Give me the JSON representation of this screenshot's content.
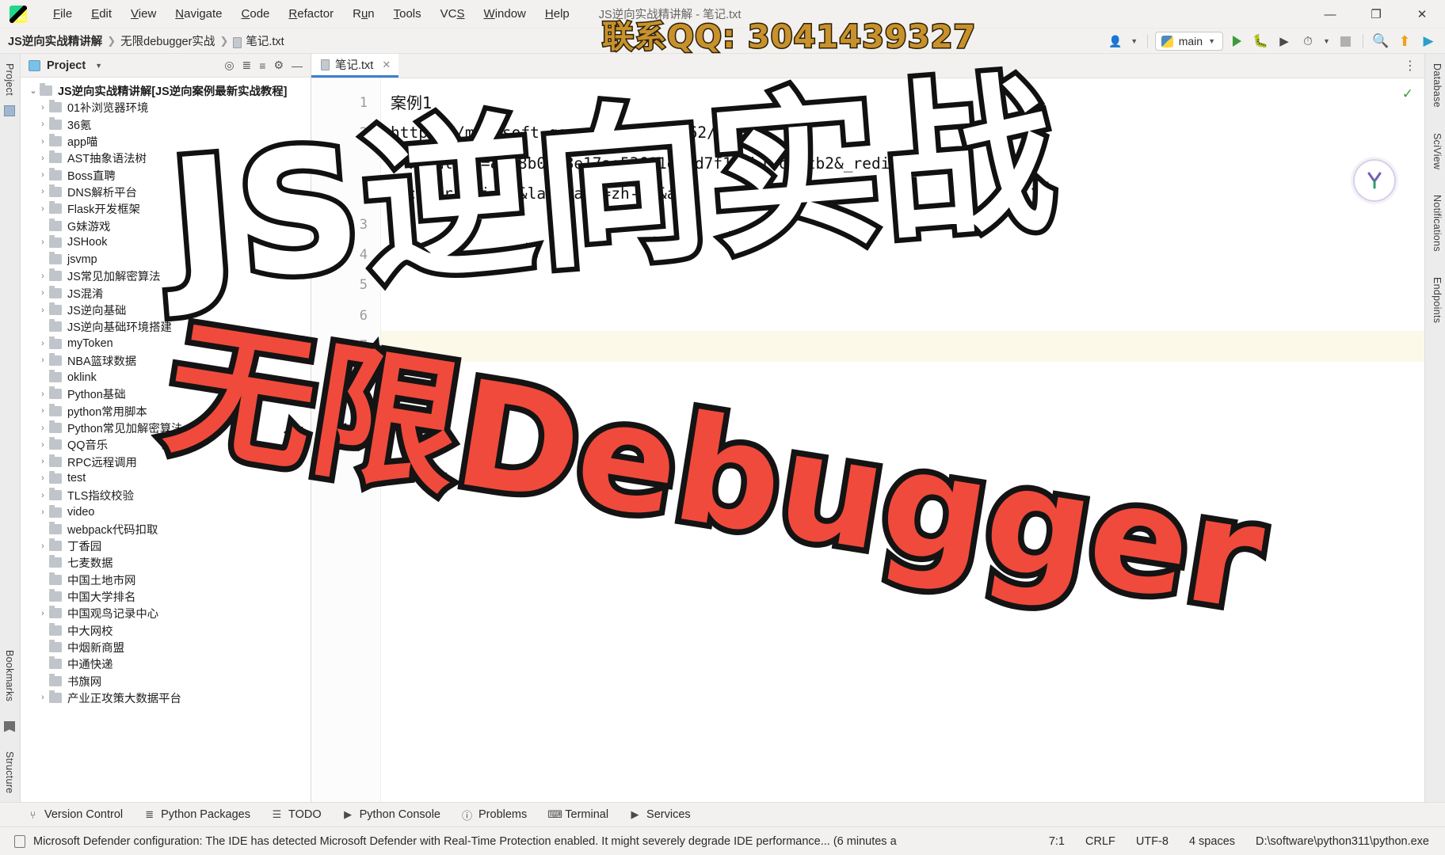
{
  "window": {
    "title": "JS逆向实战精讲解 - 笔记.txt",
    "app_icon": "pycharm-logo-icon",
    "minimize": "—",
    "maximize": "❐",
    "close": "✕"
  },
  "menu": {
    "items": [
      {
        "label": "File",
        "mnemonic": "F"
      },
      {
        "label": "Edit",
        "mnemonic": "E"
      },
      {
        "label": "View",
        "mnemonic": "V"
      },
      {
        "label": "Navigate",
        "mnemonic": "N"
      },
      {
        "label": "Code",
        "mnemonic": "C"
      },
      {
        "label": "Refactor",
        "mnemonic": "R"
      },
      {
        "label": "Run",
        "mnemonic": "u"
      },
      {
        "label": "Tools",
        "mnemonic": "T"
      },
      {
        "label": "VCS",
        "mnemonic": "S"
      },
      {
        "label": "Window",
        "mnemonic": "W"
      },
      {
        "label": "Help",
        "mnemonic": "H"
      }
    ]
  },
  "breadcrumb": {
    "items": [
      "JS逆向实战精讲解",
      "无限debugger实战",
      "笔记.txt"
    ],
    "separator": "❯"
  },
  "toolbar": {
    "user_icon": "user-account-icon",
    "run_config": {
      "label": "main",
      "icon": "python-file-icon",
      "caret": "▼"
    },
    "run_label": "Run",
    "debug_label": "Debug",
    "run_coverage_label": "Run with Coverage",
    "profile_label": "Profile",
    "stop_label": "Stop",
    "search_label": "Search Everywhere",
    "search_icon": "magnifier-icon",
    "update_icon": "update-project-icon",
    "ai_icon": "ai-assistant-icon"
  },
  "project_panel": {
    "title": "Project",
    "dropdown_caret": "▼",
    "icons": [
      "select-opened-file-icon",
      "expand-all-icon",
      "collapse-all-icon",
      "settings-gear-icon",
      "hide-panel-icon"
    ],
    "tree": [
      {
        "label": "JS逆向实战精讲解",
        "suffix": " [JS逆向案例最新实战教程]",
        "arrow": "⌄",
        "depth": 0,
        "root": true
      },
      {
        "label": "01补浏览器环境",
        "arrow": "›",
        "depth": 1
      },
      {
        "label": "36氪",
        "arrow": "›",
        "depth": 1
      },
      {
        "label": "app喵",
        "arrow": "›",
        "depth": 1
      },
      {
        "label": "AST抽象语法树",
        "arrow": "›",
        "depth": 1
      },
      {
        "label": "Boss直聘",
        "arrow": "›",
        "depth": 1
      },
      {
        "label": "DNS解析平台",
        "arrow": "›",
        "depth": 1
      },
      {
        "label": "Flask开发框架",
        "arrow": "›",
        "depth": 1
      },
      {
        "label": "G妹游戏",
        "arrow": "",
        "depth": 1
      },
      {
        "label": "JSHook",
        "arrow": "›",
        "depth": 1
      },
      {
        "label": "jsvmp",
        "arrow": "",
        "depth": 1
      },
      {
        "label": "JS常见加解密算法",
        "arrow": "›",
        "depth": 1
      },
      {
        "label": "JS混淆",
        "arrow": "›",
        "depth": 1
      },
      {
        "label": "JS逆向基础",
        "arrow": "›",
        "depth": 1
      },
      {
        "label": "JS逆向基础环境搭建",
        "arrow": "",
        "depth": 1
      },
      {
        "label": "myToken",
        "arrow": "›",
        "depth": 1
      },
      {
        "label": "NBA篮球数据",
        "arrow": "›",
        "depth": 1
      },
      {
        "label": "oklink",
        "arrow": "",
        "depth": 1
      },
      {
        "label": "Python基础",
        "arrow": "›",
        "depth": 1
      },
      {
        "label": "python常用脚本",
        "arrow": "›",
        "depth": 1
      },
      {
        "label": "Python常见加解密算法",
        "arrow": "›",
        "depth": 1
      },
      {
        "label": "QQ音乐",
        "arrow": "›",
        "depth": 1
      },
      {
        "label": "RPC远程调用",
        "arrow": "›",
        "depth": 1
      },
      {
        "label": "test",
        "arrow": "›",
        "depth": 1
      },
      {
        "label": "TLS指纹校验",
        "arrow": "›",
        "depth": 1
      },
      {
        "label": "video",
        "arrow": "›",
        "depth": 1
      },
      {
        "label": "webpack代码扣取",
        "arrow": "",
        "depth": 1
      },
      {
        "label": "丁香园",
        "arrow": "›",
        "depth": 1
      },
      {
        "label": "七麦数据",
        "arrow": "",
        "depth": 1
      },
      {
        "label": "中国土地市网",
        "arrow": "",
        "depth": 1
      },
      {
        "label": "中国大学排名",
        "arrow": "",
        "depth": 1
      },
      {
        "label": "中国观鸟记录中心",
        "arrow": "›",
        "depth": 1
      },
      {
        "label": "中大网校",
        "arrow": "",
        "depth": 1
      },
      {
        "label": "中烟新商盟",
        "arrow": "",
        "depth": 1
      },
      {
        "label": "中通快递",
        "arrow": "",
        "depth": 1
      },
      {
        "label": "书旗网",
        "arrow": "",
        "depth": 1
      },
      {
        "label": "产业正攻策大数据平台",
        "arrow": "›",
        "depth": 1
      }
    ]
  },
  "editor": {
    "tab": {
      "label": "笔记.txt",
      "icon": "text-file-icon",
      "close": "✕"
    },
    "options_icon": "more-options-icon",
    "inspection_ok": "✓",
    "sciview_icon": "sciview-icon",
    "lines": [
      {
        "num": "1",
        "text": "案例1",
        "cjk": true
      },
      {
        "num": "2",
        "text": "https://m.pgsoft-games.com/1543462/index",
        "cjk": false
      },
      {
        "num": "",
        "text": ".html?ot=82b8b0f88e17ae53611e6dd7f167b1dcb1tb2&_redirect",
        "cjk": false,
        "cont": true
      },
      {
        "num": "",
        "text": "com&ri=ti=1s&language=zh-cn&a",
        "cjk": false,
        "cont": true
      },
      {
        "num": "3",
        "text": "",
        "cjk": false
      },
      {
        "num": "4",
        "text": "",
        "cjk": false
      },
      {
        "num": "5",
        "text": "",
        "cjk": false
      },
      {
        "num": "6",
        "text": "",
        "cjk": false
      },
      {
        "num": "7",
        "text": "",
        "cjk": false,
        "caret": true
      },
      {
        "num": "8",
        "text": "",
        "cjk": false
      },
      {
        "num": "9",
        "text": "",
        "cjk": false
      },
      {
        "num": "10",
        "text": "",
        "cjk": false
      }
    ]
  },
  "left_stripe": {
    "top_label": "Project",
    "bookmarks_label": "Bookmarks",
    "structure_label": "Structure"
  },
  "right_stripe": {
    "labels": [
      "Database",
      "SciView",
      "Notifications",
      "Endpoints"
    ]
  },
  "bottom_bar": {
    "items": [
      {
        "label": "Version Control",
        "icon": "branch-icon"
      },
      {
        "label": "Python Packages",
        "icon": "packages-icon"
      },
      {
        "label": "TODO",
        "icon": "todo-list-icon"
      },
      {
        "label": "Python Console",
        "icon": "python-console-icon"
      },
      {
        "label": "Problems",
        "icon": "problems-icon"
      },
      {
        "label": "Terminal",
        "icon": "terminal-icon"
      },
      {
        "label": "Services",
        "icon": "services-icon"
      }
    ]
  },
  "status_bar": {
    "message": "Microsoft Defender configuration: The IDE has detected Microsoft Defender with Real-Time Protection enabled. It might severely degrade IDE performance... (6 minutes a",
    "message_icon": "notification-icon",
    "caret_position": "7:1",
    "line_separator": "CRLF",
    "encoding": "UTF-8",
    "indent": "4 spaces",
    "interpreter": "D:\\software\\python311\\python.exe"
  },
  "watermarks": {
    "qq": "联系QQ: 3041439327",
    "qq_color": "#c8912c",
    "title_main": "JS逆向实战",
    "title_main_color": "#ffffff",
    "title_sub": "无限Debugger",
    "title_sub_color": "#f04a3c",
    "outline_color": "#111111"
  }
}
